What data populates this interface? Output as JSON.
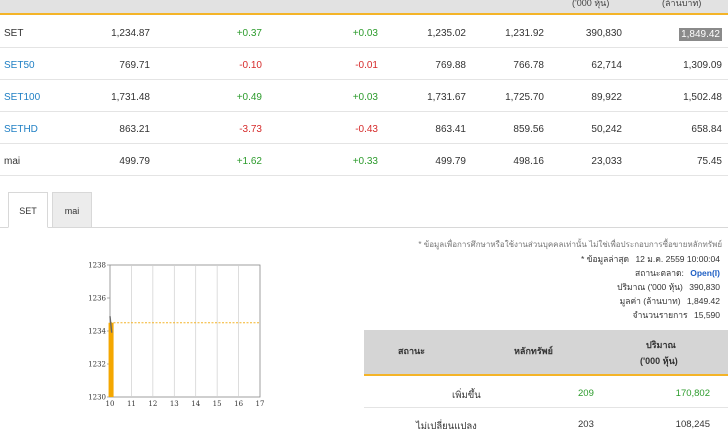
{
  "header": {
    "col6": "('000 หุ้น)",
    "col7": "(ล้านบาท)"
  },
  "indices": [
    {
      "name": "SET",
      "last": "1,234.87",
      "chg": "+0.37",
      "pct": "+0.03",
      "high": "1,235.02",
      "low": "1,231.92",
      "volume": "390,830",
      "value": "1,849.42",
      "dir": "up"
    },
    {
      "name": "SET50",
      "last": "769.71",
      "chg": "-0.10",
      "pct": "-0.01",
      "high": "769.88",
      "low": "766.78",
      "volume": "62,714",
      "value": "1,309.09",
      "dir": "down"
    },
    {
      "name": "SET100",
      "last": "1,731.48",
      "chg": "+0.49",
      "pct": "+0.03",
      "high": "1,731.67",
      "low": "1,725.70",
      "volume": "89,922",
      "value": "1,502.48",
      "dir": "up"
    },
    {
      "name": "SETHD",
      "last": "863.21",
      "chg": "-3.73",
      "pct": "-0.43",
      "high": "863.41",
      "low": "859.56",
      "volume": "50,242",
      "value": "658.84",
      "dir": "down"
    },
    {
      "name": "mai",
      "last": "499.79",
      "chg": "+1.62",
      "pct": "+0.33",
      "high": "499.79",
      "low": "498.16",
      "volume": "23,033",
      "value": "75.45",
      "dir": "up"
    }
  ],
  "tabs": [
    {
      "label": "SET"
    },
    {
      "label": "mai"
    }
  ],
  "chart_data": {
    "type": "line",
    "title": "",
    "xlabel": "",
    "ylabel": "",
    "x_ticks": [
      "10",
      "11",
      "12",
      "13",
      "14",
      "15",
      "16",
      "17"
    ],
    "y_ticks": [
      "1230",
      "1232",
      "1234",
      "1236",
      "1238"
    ],
    "ylim": [
      1230,
      1238
    ],
    "xlim": [
      10,
      17
    ],
    "reference_line": 1234.5,
    "series": [
      {
        "values": [
          [
            10.0,
            1234.9
          ],
          [
            10.08,
            1233.9
          ]
        ]
      }
    ],
    "volume_bar": {
      "x": 10.05,
      "value": 1
    },
    "grid": true,
    "colors": {
      "line": "#666666",
      "reference": "#f4b428",
      "volume": "#f4a700"
    }
  },
  "info": {
    "disclaimer": "* ข้อมูลเพื่อการศึกษาหรือใช้งานส่วนบุคคลเท่านั้น ไม่ใช่เพื่อประกอบการซื้อขายหลักทรัพย์",
    "updated_label": "* ข้อมูลล่าสุด",
    "updated_value": "12 ม.ค. 2559 10:00:04",
    "status_label": "สถานะตลาด:",
    "status_value": "Open(I)",
    "volume_label": "ปริมาณ ('000 หุ้น)",
    "volume_value": "390,830",
    "value_label": "มูลค่า (ล้านบาท)",
    "value_value": "1,849.42",
    "deals_label": "จำนวนรายการ",
    "deals_value": "15,590"
  },
  "breadth": {
    "headers": {
      "status": "สถานะ",
      "securities": "หลักทรัพย์",
      "volume": "ปริมาณ",
      "volume_unit": "('000 หุ้น)"
    },
    "rows": [
      {
        "status": "เพิ่มขึ้น",
        "securities": "209",
        "volume": "170,802",
        "dir": "up"
      },
      {
        "status": "ไม่เปลี่ยนแปลง",
        "securities": "203",
        "volume": "108,245",
        "dir": "flat"
      }
    ]
  },
  "colors": {
    "accent": "#f4b428",
    "up": "#2c9b2c",
    "down": "#d62b2b",
    "link": "#1f7fc4"
  }
}
